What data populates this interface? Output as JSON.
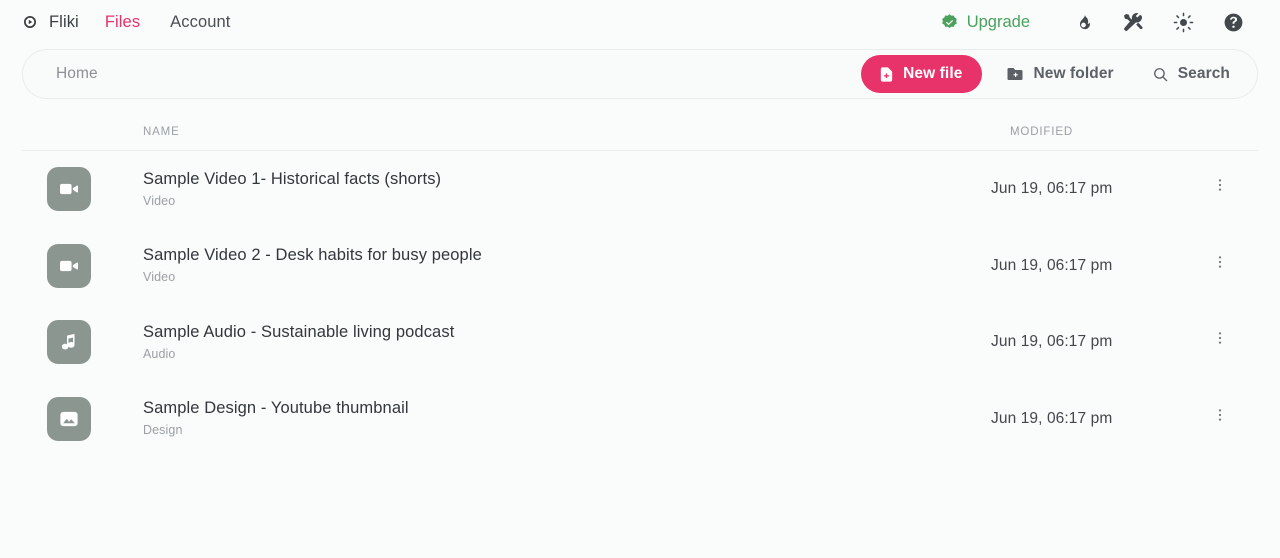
{
  "app": {
    "brand": "Fliki",
    "logo_icon": "fliki-gear-play-logo"
  },
  "nav": {
    "links": [
      {
        "label": "Files",
        "active": true
      },
      {
        "label": "Account",
        "active": false
      }
    ],
    "upgrade": {
      "label": "Upgrade",
      "icon": "verified-badge-icon",
      "color": "#49a15c"
    },
    "icons": [
      {
        "name": "flame-icon",
        "title": "Streak"
      },
      {
        "name": "tools-icon",
        "title": "Tools"
      },
      {
        "name": "sun-icon",
        "title": "Theme"
      },
      {
        "name": "help-circle-icon",
        "title": "Help"
      }
    ]
  },
  "toolbar": {
    "breadcrumb": "Home",
    "new_file_label": "New file",
    "new_folder_label": "New folder",
    "search_label": "Search",
    "accent_color": "#e8326a"
  },
  "table": {
    "columns": {
      "name": "NAME",
      "modified": "MODIFIED"
    },
    "rows": [
      {
        "title": "Sample Video 1- Historical facts (shorts)",
        "type": "Video",
        "modified": "Jun 19, 06:17 pm",
        "icon": "video-camera-icon",
        "thumb_color": "#8b9691"
      },
      {
        "title": "Sample Video 2 - Desk habits for busy people",
        "type": "Video",
        "modified": "Jun 19, 06:17 pm",
        "icon": "video-camera-icon",
        "thumb_color": "#8b9691"
      },
      {
        "title": "Sample Audio - Sustainable living podcast",
        "type": "Audio",
        "modified": "Jun 19, 06:17 pm",
        "icon": "music-note-icon",
        "thumb_color": "#8b9691"
      },
      {
        "title": "Sample Design - Youtube thumbnail",
        "type": "Design",
        "modified": "Jun 19, 06:17 pm",
        "icon": "image-icon",
        "thumb_color": "#8b9691"
      }
    ]
  }
}
